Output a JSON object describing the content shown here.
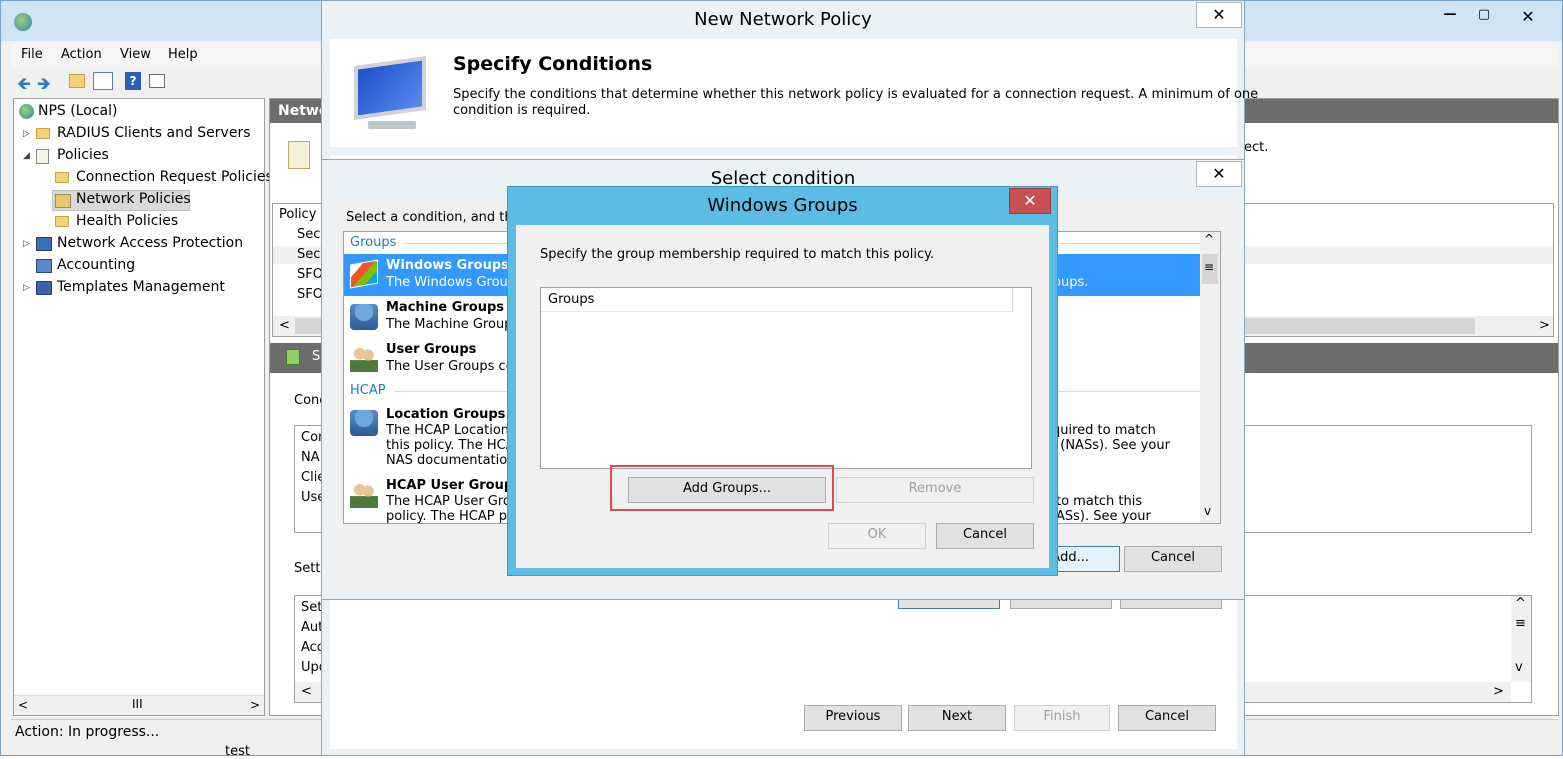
{
  "menu": [
    "File",
    "Action",
    "View",
    "Help"
  ],
  "window_controls": {
    "min": "—",
    "max": "▢",
    "close": "✕"
  },
  "tree": {
    "root": "NPS (Local)",
    "items": [
      {
        "label": "RADIUS Clients and Servers"
      },
      {
        "label": "Policies"
      },
      {
        "label": "Connection Request Policies"
      },
      {
        "label": "Network Policies"
      },
      {
        "label": "Health Policies"
      },
      {
        "label": "Network Access Protection"
      },
      {
        "label": "Accounting"
      },
      {
        "label": "Templates Management"
      }
    ]
  },
  "right_bg": {
    "header": "Netwo",
    "text_fragment": "ect.",
    "col_header": "Policy N",
    "rows": [
      "Secu",
      "Secu",
      "SFO",
      "SFO"
    ],
    "section_label": "S",
    "cond_label": "Conc",
    "cond_rows": [
      "Cor",
      "NA",
      "Clie",
      "Use"
    ],
    "sett_label": "Setti",
    "sett_rows": [
      "Set",
      "Auth",
      "Acc",
      "Upd"
    ]
  },
  "status": {
    "text": "Action:  In progress..."
  },
  "tree_bottom": "test",
  "nnp": {
    "title": "New Network Policy",
    "heading": "Specify Conditions",
    "desc1": "Specify the conditions that determine whether this network policy is evaluated for a connection request. A minimum of one",
    "desc2": "condition is required.",
    "buttons": {
      "previous": "Previous",
      "next": "Next",
      "finish": "Finish",
      "cancel": "Cancel"
    }
  },
  "sc": {
    "title": "Select condition",
    "prompt": "Select a condition, and then",
    "group1": "Groups",
    "group2": "HCAP",
    "items": [
      {
        "title": "Windows Groups",
        "desc": "The Windows Groups",
        "desc_right": "oups."
      },
      {
        "title": "Machine Groups",
        "desc": "The Machine Groups"
      },
      {
        "title": "User Groups",
        "desc": "The User Groups con"
      },
      {
        "title": "Location Groups",
        "desc1": "The HCAP Location",
        "desc2": "this policy. The HCAP",
        "desc3": "NAS documentation b",
        "r1": "equired to match",
        "r2": "rs (NASs). See your"
      },
      {
        "title": "HCAP User Groups",
        "desc1": "The HCAP User Grou",
        "desc2": "policy. The HCAP pro",
        "r1": "to match this",
        "r2": "ASs). See your"
      }
    ],
    "add_label": "Add...",
    "cancel_label": "Cancel"
  },
  "wg": {
    "title": "Windows Groups",
    "desc": "Specify the group membership required to match this policy.",
    "list_header": "Groups",
    "add_groups": "Add Groups...",
    "remove": "Remove",
    "ok": "OK",
    "cancel": "Cancel"
  },
  "colors": {
    "accent": "#5bbde4",
    "close_red": "#c75050",
    "selection": "#3399ff",
    "highlight": "#e04a4a"
  }
}
